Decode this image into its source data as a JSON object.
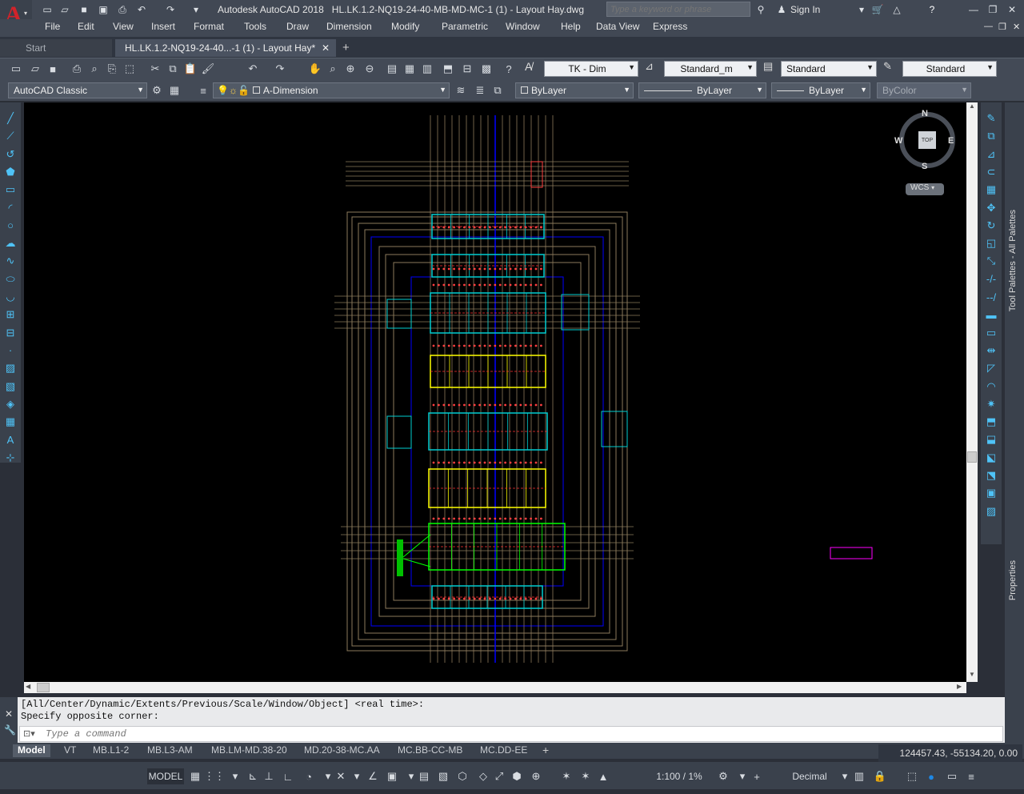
{
  "title": {
    "app": "Autodesk AutoCAD 2018",
    "file": "HL.LK.1.2-NQ19-24-40-MB-MD-MC-1 (1) - Layout Hay.dwg",
    "search_placeholder": "Type a keyword or phrase",
    "sign_in": "Sign In"
  },
  "menu": [
    "File",
    "Edit",
    "View",
    "Insert",
    "Format",
    "Tools",
    "Draw",
    "Dimension",
    "Modify",
    "Parametric",
    "Window",
    "Help",
    "Data View",
    "Express"
  ],
  "doc_tabs": {
    "start": "Start",
    "active": "HL.LK.1.2-NQ19-24-40...-1 (1) - Layout Hay*",
    "add": "+"
  },
  "toolbar1": {
    "dimstyle": "TK - Dim",
    "mleader": "Standard_m",
    "tablestyle": "Standard",
    "textstyle": "Standard"
  },
  "toolbar2": {
    "workspace": "AutoCAD Classic",
    "layer": "A-Dimension",
    "color": "ByLayer",
    "linetype": "ByLayer",
    "lineweight": "ByLayer",
    "plotstyle": "ByColor"
  },
  "viewcube": {
    "n": "N",
    "s": "S",
    "e": "E",
    "w": "W",
    "top": "TOP",
    "wcs": "WCS"
  },
  "command": {
    "line1": "[All/Center/Dynamic/Extents/Previous/Scale/Window/Object] <real time>:",
    "line2": "Specify opposite corner:",
    "placeholder": "Type a command"
  },
  "layout_tabs": [
    "Model",
    "VT",
    "MB.L1-2",
    "MB.L3-AM",
    "MB.LM-MD.38-20",
    "MD.20-38-MC.AA",
    "MC.BB-CC-MB",
    "MC.DD-EE"
  ],
  "coords": "124457.43, -55134.20, 0.00",
  "status": {
    "model": "MODEL",
    "scale": "1:100 / 1%",
    "units": "Decimal"
  },
  "palettes": {
    "tool": "Tool Palettes - All Palettes",
    "props": "Properties"
  },
  "colors": {
    "canvas": "#000000",
    "chrome": "#414854",
    "accent": "#d2232a"
  }
}
